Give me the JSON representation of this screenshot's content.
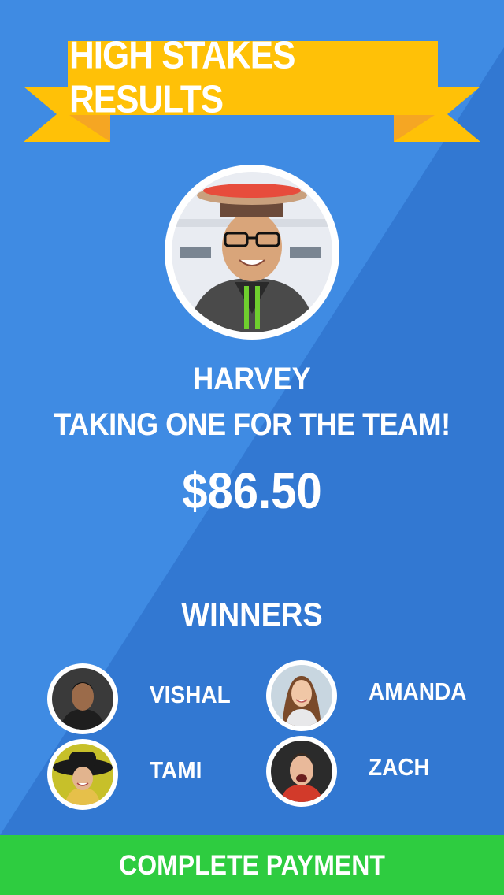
{
  "banner": {
    "title": "HIGH STAKES RESULTS"
  },
  "loser": {
    "name": "HARVEY",
    "subtitle": "TAKING ONE FOR THE TEAM!",
    "amount": "$86.50"
  },
  "winners": {
    "title": "WINNERS",
    "items": [
      {
        "name": "VISHAL"
      },
      {
        "name": "AMANDA"
      },
      {
        "name": "TAMI"
      },
      {
        "name": "ZACH"
      }
    ]
  },
  "footer": {
    "button_label": "COMPLETE PAYMENT"
  },
  "colors": {
    "background": "#3f8be3",
    "background_shade": "#3278d2",
    "banner": "#ffc107",
    "banner_fold": "#f5a623",
    "button": "#2ecc40",
    "text": "#ffffff"
  }
}
